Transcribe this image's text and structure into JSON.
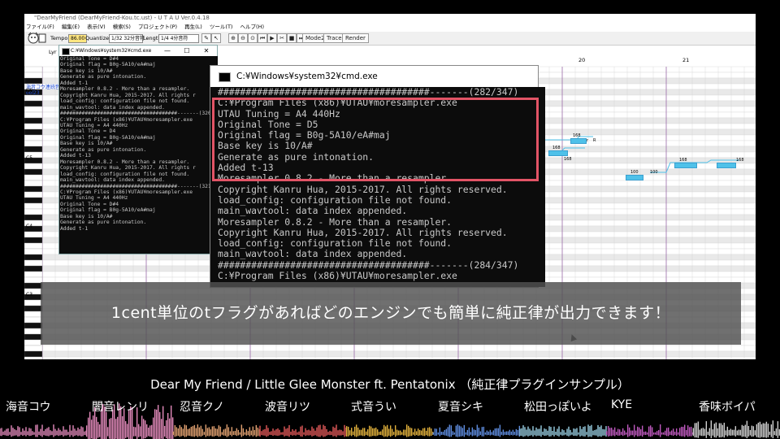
{
  "utau": {
    "title": "\"DearMyFriend (DearMyFriend-Kou.tc.ust) - U T A U Ver.0.4.18",
    "menu": [
      "ファイル(F)",
      "編集(E)",
      "表示(V)",
      "検索(S)",
      "プロジェクト(P)",
      "再生(L)",
      "ツール(T)",
      "ヘルプ(H)"
    ],
    "toolbar": {
      "tempo_label": "Tempo",
      "tempo_value": "86.00",
      "quantize_label": "Quantize",
      "quantize_value": "1/32 32分音符",
      "length_label": "Length",
      "length_value": "1/4 4分音符",
      "mode2": "Mode2",
      "trace": "Trace",
      "render": "Render"
    },
    "lyric_label": "Lyr",
    "side_lines": [
      "海音コウ連続音",
      "ool23"
    ],
    "octaves": [
      "C6",
      "C5",
      "C4",
      "C3",
      "C2"
    ],
    "bars": [
      "20",
      "21"
    ],
    "note_labels": [
      "r",
      "R",
      "168",
      "168",
      "168",
      "168",
      "100",
      "100",
      "168"
    ],
    "colors": {
      "note": "#4fc1e9",
      "highlight": "#e25466"
    }
  },
  "cmd_small": {
    "title": "C:¥Windows¥system32¥cmd.exe",
    "lines": [
      "Original Tone = D#4",
      "Original flag = B0g-5A10/eA#maj",
      "Base key is 10/A#",
      "Generate as pure intonation.",
      "Added t-1",
      "Moresampler 0.8.2 - More than a resampler.",
      "Copyright Kanru Hua, 2015-2017. All rights r",
      "load_config: configuration file not found.",
      "main_wavtool: data index appended.",
      "######################################-------(320/3",
      "C:¥Program Files (x86)¥UTAU¥moresampler.exe",
      "UTAU Tuning = A4 440Hz",
      "Original Tone = D4",
      "Original flag = B0g-5A10/eA#maj",
      "Base key is 10/A#",
      "Generate as pure intonation.",
      "Added t-13",
      "Moresampler 0.8.2 - More than a resampler.",
      "Copyright Kanru Hua, 2015-2017. All rights r",
      "load_config: configuration file not found.",
      "main_wavtool: data index appended.",
      "######################################-------(321/3",
      "C:¥Program Files (x86)¥UTAU¥moresampler.exe",
      "UTAU Tuning = A4 440Hz",
      "Original Tone = D#4",
      "Original flag = B0g-5A10/eA#maj",
      "Base key is 10/A#",
      "Generate as pure intonation.",
      "Added t-1"
    ]
  },
  "cmd_large": {
    "title": "C:¥Windows¥system32¥cmd.exe",
    "lines": [
      "######################################-------(282/347)",
      "C:¥Program Files (x86)¥UTAU¥moresampler.exe",
      "UTAU Tuning = A4 440Hz",
      "Original Tone = D5",
      "Original flag = B0g-5A10/eA#maj",
      "Base key is 10/A#",
      "Generate as pure intonation.",
      "Added t-13",
      "Moresampler 0.8.2 - More than a resampler.",
      "Copyright Kanru Hua, 2015-2017. All rights reserved.",
      "load_config: configuration file not found.",
      "main_wavtool: data index appended.",
      "Moresampler 0.8.2 - More than a resampler.",
      "Copyright Kanru Hua, 2015-2017. All rights reserved.",
      "load_config: configuration file not found.",
      "main_wavtool: data index appended.",
      "######################################-------(284/347)",
      "C:¥Program Files (x86)¥UTAU¥moresampler.exe"
    ]
  },
  "subtitle": "1cent単位のtフラグがあればどのエンジンでも簡単に純正律が出力できます！",
  "song_title": "Dear My Friend / Little Glee Monster ft. Pentatonix （純正律プラグインサンプル）",
  "singers": [
    "海音コウ",
    "闇音レンリ",
    "忍音クノ",
    "波音リツ",
    "式音うい",
    "夏音シキ",
    "松田っぽいよ",
    "KYE",
    "香味ボイパ"
  ],
  "wave_colors": [
    "#e58bbd",
    "#e58bbd",
    "#e0a070",
    "#e55a5a",
    "#e3b23c",
    "#5f8de0",
    "#9ad0e5",
    "#c05ac0",
    "#d0d0d0"
  ]
}
